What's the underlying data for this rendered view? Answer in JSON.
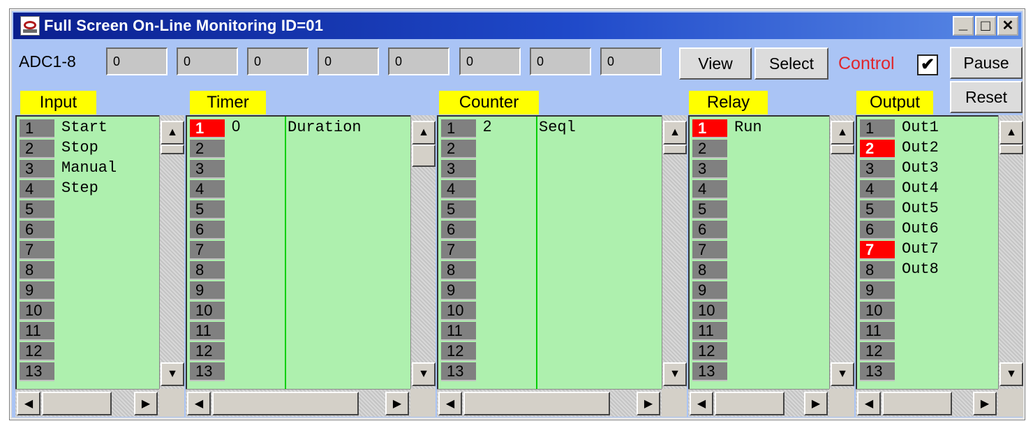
{
  "window": {
    "title": "Full Screen On-Line Monitoring ID=01",
    "controls": {
      "minimize": "_",
      "maximize": "□",
      "close": "✕"
    }
  },
  "adc": {
    "label": "ADC1-8",
    "values": [
      "0",
      "0",
      "0",
      "0",
      "0",
      "0",
      "0",
      "0"
    ]
  },
  "toolbar": {
    "view_label": "View",
    "select_label": "Select",
    "control_label": "Control",
    "control_checked": "✔",
    "pause_label": "Pause",
    "reset_label": "Reset"
  },
  "sections": {
    "input": {
      "label": "Input",
      "rows": [
        "1",
        "2",
        "3",
        "4",
        "5",
        "6",
        "7",
        "8",
        "9",
        "10",
        "11",
        "12",
        "13"
      ],
      "names": [
        "Start",
        "Stop",
        "Manual",
        "Step"
      ]
    },
    "timer": {
      "label": "Timer",
      "rows": [
        "1",
        "2",
        "3",
        "4",
        "5",
        "6",
        "7",
        "8",
        "9",
        "10",
        "11",
        "12",
        "13"
      ],
      "first_value": "0",
      "first_name": "Duration"
    },
    "counter": {
      "label": "Counter",
      "rows": [
        "1",
        "2",
        "3",
        "4",
        "5",
        "6",
        "7",
        "8",
        "9",
        "10",
        "11",
        "12",
        "13"
      ],
      "first_value": "2",
      "first_name": "Seql"
    },
    "relay": {
      "label": "Relay",
      "rows": [
        "1",
        "2",
        "3",
        "4",
        "5",
        "6",
        "7",
        "8",
        "9",
        "10",
        "11",
        "12",
        "13"
      ],
      "first_name": "Run"
    },
    "output": {
      "label": "Output",
      "rows": [
        "1",
        "2",
        "3",
        "4",
        "5",
        "6",
        "7",
        "8",
        "9",
        "10",
        "11",
        "12",
        "13"
      ],
      "names": [
        "Out1",
        "Out2",
        "Out3",
        "Out4",
        "Out5",
        "Out6",
        "Out7",
        "Out8"
      ]
    }
  },
  "active_rows": {
    "timer": [
      "1"
    ],
    "relay": [
      "1"
    ],
    "output": [
      "2",
      "7"
    ]
  },
  "colors": {
    "background": "#aac4f5",
    "list_bg": "#aef0ae",
    "label_bg": "#ffff00",
    "active": "#ff0000",
    "control_text": "#e0262b",
    "divider": "#00d000"
  }
}
